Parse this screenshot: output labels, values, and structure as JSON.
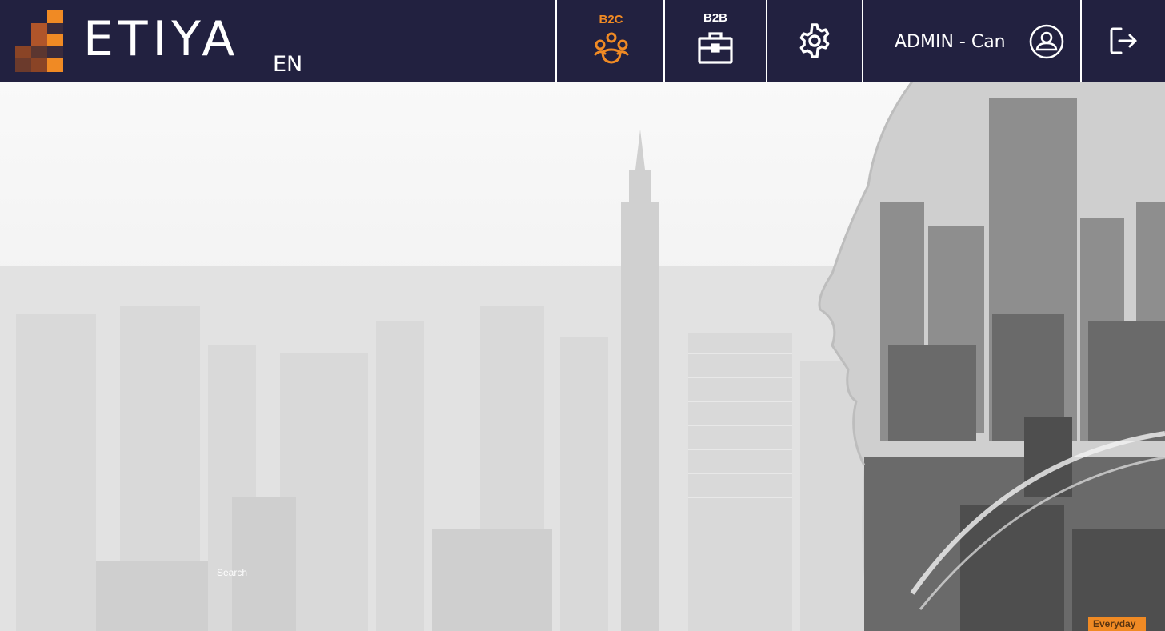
{
  "header": {
    "brand": "ETIYA",
    "language": "EN",
    "tabs": [
      {
        "label": "B2C",
        "icon": "customers-group-icon",
        "active": true
      },
      {
        "label": "B2B",
        "icon": "briefcase-icon",
        "active": false
      }
    ],
    "settings_icon": "gear-icon",
    "user": {
      "name": "ADMIN - Can",
      "icon": "user-avatar-icon"
    },
    "logout_icon": "logout-icon"
  },
  "hero": {
    "search_label": "Search",
    "badge": "Everyday"
  },
  "colors": {
    "header_bg": "#222140",
    "accent": "#f08a24",
    "text_light": "#ffffff"
  }
}
